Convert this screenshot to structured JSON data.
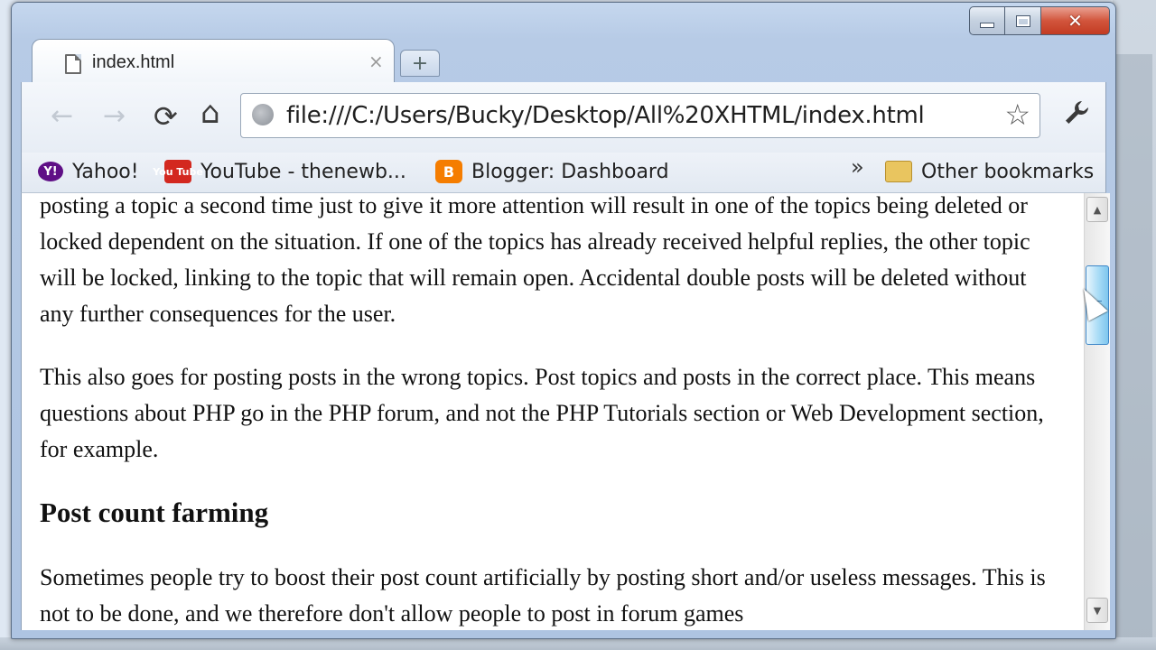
{
  "window": {
    "caption": {
      "minimize": "minimize",
      "maximize": "maximize",
      "close": "✕"
    }
  },
  "tabs": [
    {
      "title": "index.html",
      "close": "×"
    }
  ],
  "new_tab": "+",
  "toolbar": {
    "back": "←",
    "forward": "→",
    "reload": "⟳",
    "home": "⌂",
    "url": "file:///C:/Users/Bucky/Desktop/All%20XHTML/index.html",
    "star": "☆",
    "wrench": "🔧"
  },
  "bookmarks": {
    "items": [
      {
        "label": "Yahoo!",
        "icon": "yahoo-icon",
        "glyph": "Y!"
      },
      {
        "label": "YouTube - thenewb...",
        "icon": "youtube-icon",
        "glyph": "You Tube"
      },
      {
        "label": "Blogger: Dashboard",
        "icon": "blogger-icon",
        "glyph": "B"
      }
    ],
    "overflow": "»",
    "other": "Other bookmarks"
  },
  "page": {
    "paragraphs_top": [
      "posting a topic a second time just to give it more attention will result in one of the topics being deleted or locked dependent on the situation. If one of the topics has already received helpful replies, the other topic will be locked, linking to the topic that will remain open. Accidental double posts will be deleted without any further consequences for the user.",
      "This also goes for posting posts in the wrong topics. Post topics and posts in the correct place. This means questions about PHP go in the PHP forum, and not the PHP Tutorials section or Web Development section, for example."
    ],
    "heading": "Post count farming",
    "paragraph_bottom": "Sometimes people try to boost their post count artificially by posting short and/or useless messages. This is not to be done, and we therefore don't allow people to post in forum games"
  },
  "scrollbar": {
    "up": "▲",
    "down": "▼",
    "position": 0.2
  }
}
